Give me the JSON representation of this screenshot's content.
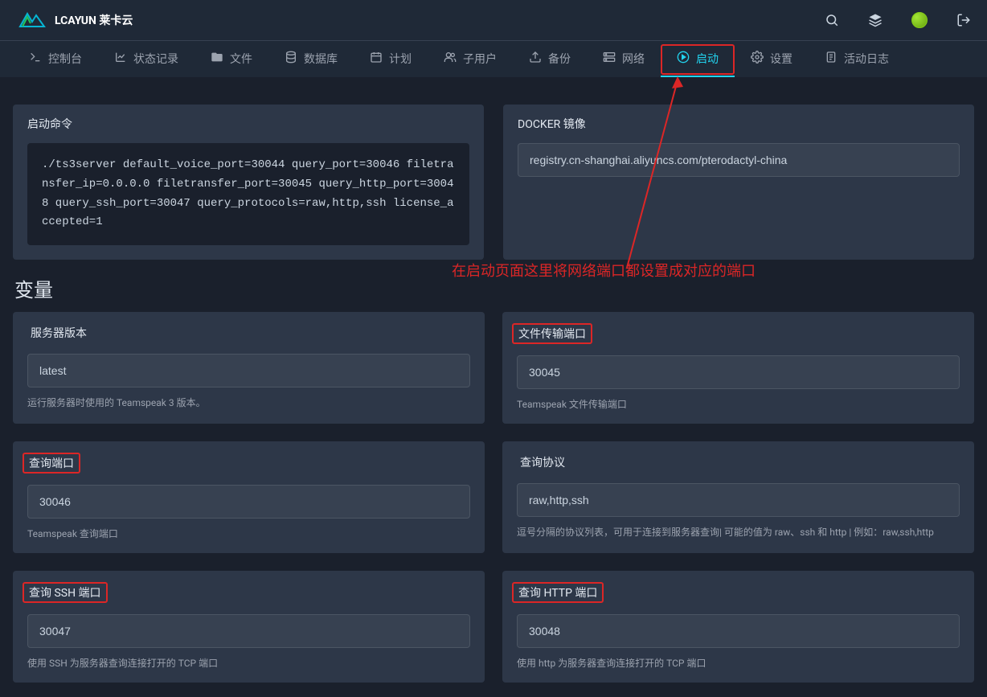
{
  "brand": "LCAYUN 莱卡云",
  "topnav": {
    "items": [
      {
        "icon": "terminal",
        "label": "控制台"
      },
      {
        "icon": "chart",
        "label": "状态记录"
      },
      {
        "icon": "folder",
        "label": "文件"
      },
      {
        "icon": "database",
        "label": "数据库"
      },
      {
        "icon": "calendar",
        "label": "计划"
      },
      {
        "icon": "users",
        "label": "子用户"
      },
      {
        "icon": "upload",
        "label": "备份"
      },
      {
        "icon": "network",
        "label": "网络"
      },
      {
        "icon": "play",
        "label": "启动"
      },
      {
        "icon": "settings",
        "label": "设置"
      },
      {
        "icon": "book",
        "label": "活动日志"
      }
    ],
    "active_index": 8
  },
  "panels": {
    "startup": {
      "title": "启动命令",
      "command": "./ts3server default_voice_port=30044 query_port=30046 filetransfer_ip=0.0.0.0 filetransfer_port=30045 query_http_port=30048 query_ssh_port=30047 query_protocols=raw,http,ssh license_accepted=1"
    },
    "docker": {
      "title": "DOCKER 镜像",
      "value": "registry.cn-shanghai.aliyuncs.com/pterodactyl-china"
    }
  },
  "variables_title": "变量",
  "variables": [
    {
      "label": "服务器版本",
      "value": "latest",
      "desc": "运行服务器时使用的 Teamspeak 3 版本。",
      "highlight": false
    },
    {
      "label": "文件传输端口",
      "value": "30045",
      "desc": "Teamspeak 文件传输端口",
      "highlight": true
    },
    {
      "label": "查询端口",
      "value": "30046",
      "desc": "Teamspeak 查询端口",
      "highlight": true
    },
    {
      "label": "查询协议",
      "value": "raw,http,ssh",
      "desc": "逗号分隔的协议列表，可用于连接到服务器查询| 可能的值为 raw、ssh 和 http | 例如：raw,ssh,http",
      "highlight": false
    },
    {
      "label": "查询 SSH 端口",
      "value": "30047",
      "desc": "使用 SSH 为服务器查询连接打开的 TCP 端口",
      "highlight": true
    },
    {
      "label": "查询 HTTP 端口",
      "value": "30048",
      "desc": "使用 http 为服务器查询连接打开的 TCP 端口",
      "highlight": true
    }
  ],
  "annotation": "在启动页面这里将网络端口都设置成对应的端口"
}
